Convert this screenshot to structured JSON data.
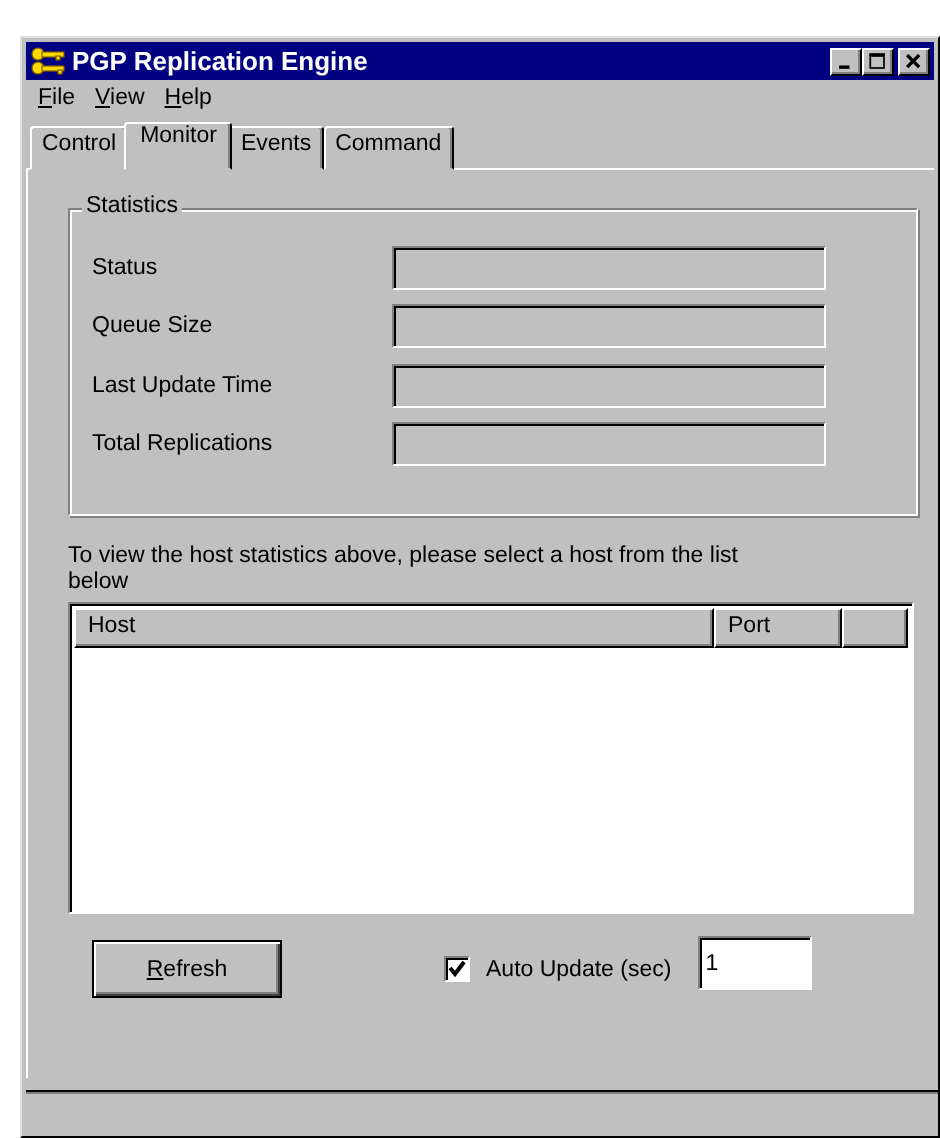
{
  "window": {
    "title": "PGP Replication Engine"
  },
  "menu": [
    {
      "label": "File",
      "mnemonic_first": true
    },
    {
      "label": "View",
      "mnemonic_first": true
    },
    {
      "label": "Help",
      "mnemonic_first": true
    }
  ],
  "tabs": [
    {
      "label": "Control",
      "selected": false
    },
    {
      "label": "Monitor",
      "selected": true
    },
    {
      "label": "Events",
      "selected": false
    },
    {
      "label": "Command",
      "selected": false
    }
  ],
  "statistics": {
    "title": "Statistics",
    "fields": [
      {
        "label": "Status"
      },
      {
        "label": "Queue Size"
      },
      {
        "label": "Last Update Time"
      },
      {
        "label": "Total Replications"
      }
    ]
  },
  "hint": "To view the host statistics above, please select a host from the list below",
  "host_list": {
    "columns": [
      "Host",
      "Port"
    ]
  },
  "refresh_button": {
    "label": "Refresh",
    "mnemonic_first": true
  },
  "auto_update": {
    "label": "Auto Update (sec)",
    "checked": true,
    "value": "1"
  }
}
